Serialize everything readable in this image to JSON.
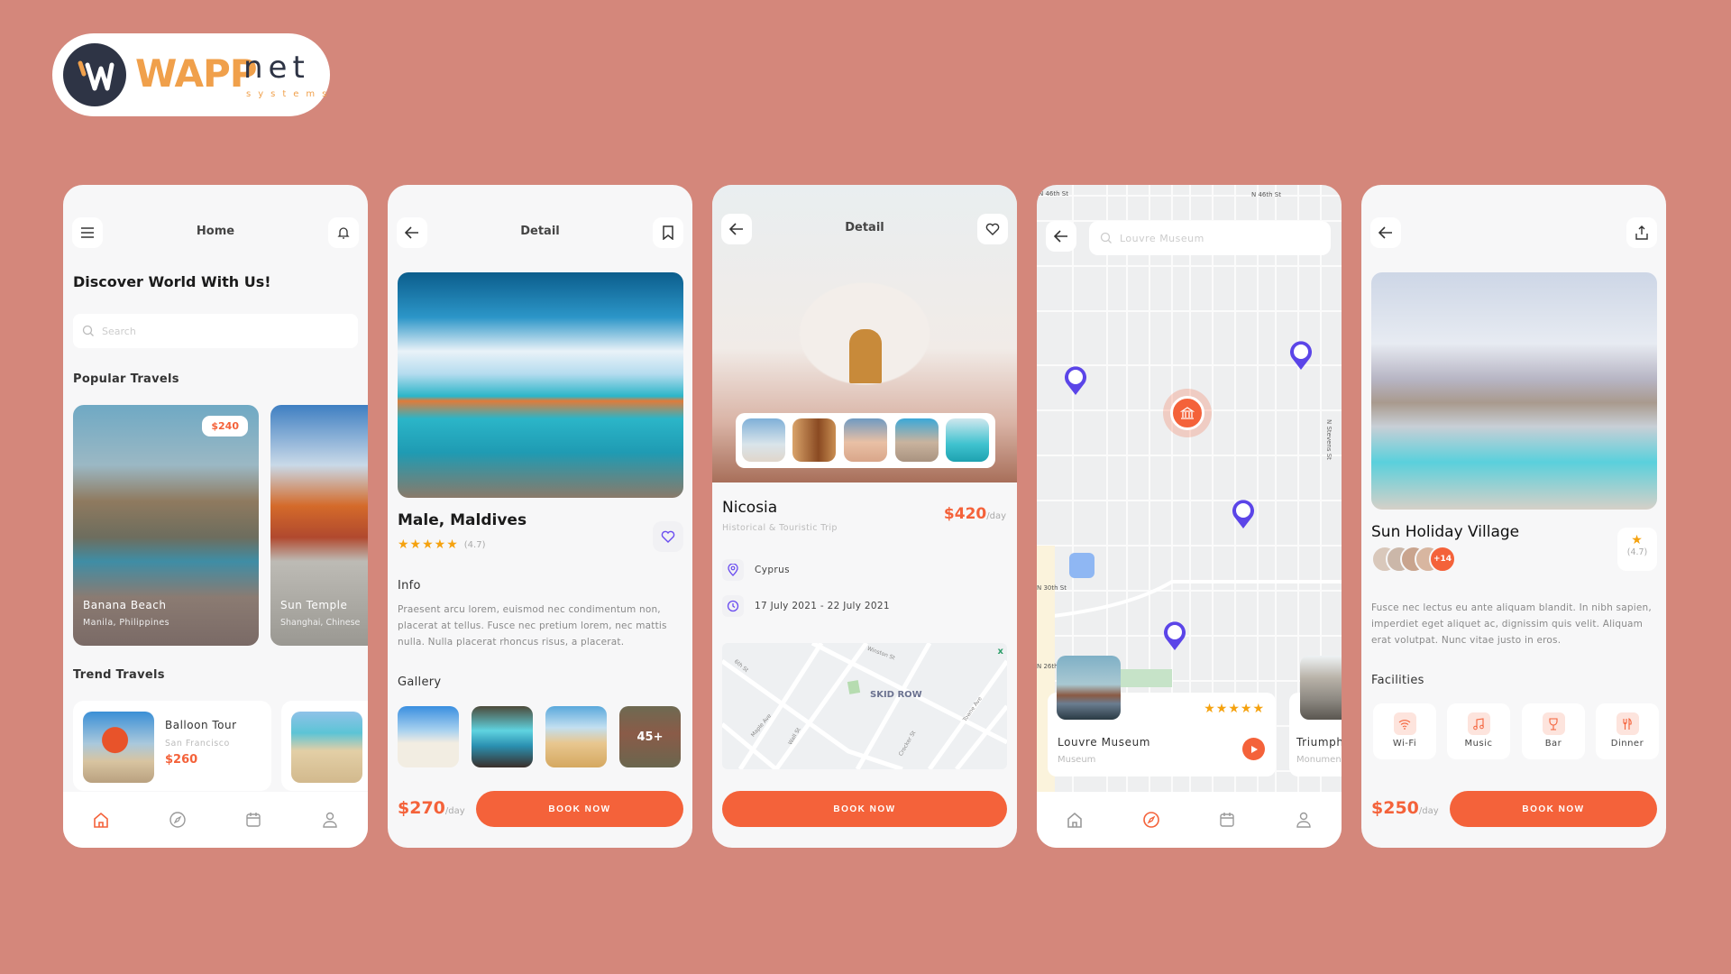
{
  "brand": {
    "logo_main": "WAPP",
    "logo_net": "net",
    "logo_sub": "systems",
    "accent": "#f4623a",
    "background": "#d4877b"
  },
  "home": {
    "title": "Home",
    "headline": "Discover World With Us!",
    "search_placeholder": "Search",
    "popular_title": "Popular Travels",
    "popular": [
      {
        "name": "Banana Beach",
        "location": "Manila, Philippines",
        "price": "$240"
      },
      {
        "name": "Sun Temple",
        "location": "Shanghai, Chinese"
      }
    ],
    "trend_title": "Trend Travels",
    "trend": [
      {
        "name": "Balloon Tour",
        "location": "San Francisco",
        "price": "$260"
      }
    ],
    "nav": [
      "home-icon",
      "compass-icon",
      "calendar-icon",
      "user-icon"
    ]
  },
  "detail1": {
    "title": "Detail",
    "place": "Male, Maldives",
    "rating": 5,
    "rating_text": "(4.7)",
    "info_title": "Info",
    "info": "Praesent arcu lorem, euismod nec condimentum non, placerat at tellus. Fusce nec pretium lorem, nec mattis nulla. Nulla placerat rhoncus risus, a placerat.",
    "gallery_title": "Gallery",
    "gallery_more": "45+",
    "price": "$270",
    "per": "/day",
    "book": "BOOK NOW"
  },
  "detail2": {
    "title": "Detail",
    "place": "Nicosia",
    "subtitle": "Historical & Touristic Trip",
    "price": "$420",
    "per": "/day",
    "location": "Cyprus",
    "dates": "17 July 2021 - 22 July 2021",
    "map_label": "SKID ROW",
    "map_streets": [
      "6th St",
      "Winston St",
      "Maple Ave",
      "Wall St",
      "Crocker St",
      "Towne Ave"
    ],
    "book": "BOOK NOW"
  },
  "map": {
    "search_value": "Louvre Museum",
    "streets": [
      "N 46th St",
      "N 46th St",
      "N Stevens St",
      "N 30th St",
      "N 26th"
    ],
    "cards": [
      {
        "name": "Louvre Museum",
        "type": "Museum",
        "rating": 5
      },
      {
        "name": "Triumph",
        "type": "Monument"
      }
    ],
    "nav": [
      "home-icon",
      "compass-icon",
      "calendar-icon",
      "user-icon"
    ]
  },
  "hotel": {
    "name": "Sun Holiday Village",
    "rating_text": "(4.7)",
    "guests_more": "+14",
    "description": "Fusce nec lectus eu ante aliquam blandit. In nibh sapien, imperdiet eget aliquet ac, dignissim quis velit. Aliquam erat volutpat. Nunc vitae justo in eros.",
    "facilities_title": "Facilities",
    "facilities": [
      {
        "label": "Wi-Fi",
        "icon": "wifi-icon"
      },
      {
        "label": "Music",
        "icon": "music-icon"
      },
      {
        "label": "Bar",
        "icon": "glass-icon"
      },
      {
        "label": "Dinner",
        "icon": "cutlery-icon"
      }
    ],
    "price": "$250",
    "per": "/day",
    "book": "BOOK NOW"
  }
}
